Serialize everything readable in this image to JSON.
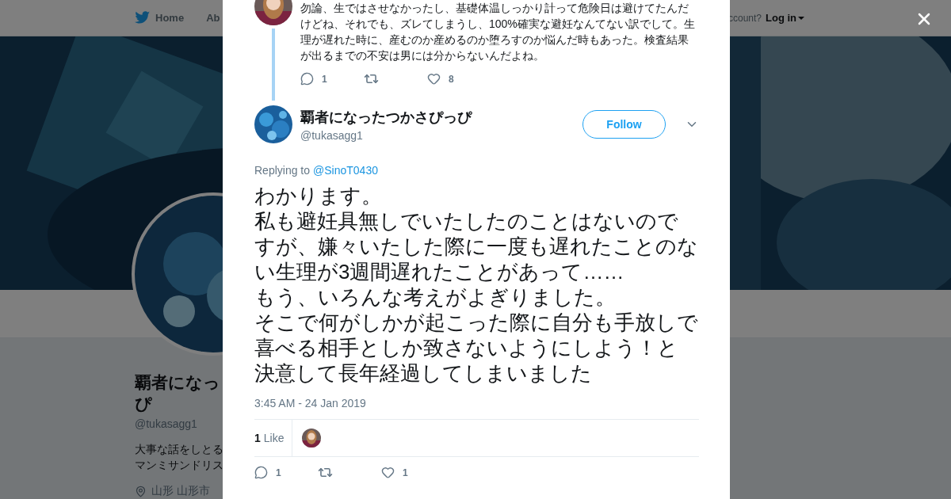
{
  "nav": {
    "items": [
      "Home",
      "Ab"
    ],
    "account_prompt": "ccount?",
    "login": "Log in"
  },
  "profile": {
    "name_lines": [
      "覇者になっ",
      "ぴ"
    ],
    "handle": "@tukasagg1",
    "bio_lines": [
      "大事な話をしとる",
      "マンミサンドリス"
    ],
    "location": "山形 山形市"
  },
  "parent_tweet": {
    "text": "勿論、生ではさせなかったし、基礎体温しっかり計って危険日は避けてたんだけどね、それでも、ズレてしまうし、100%確実な避妊なんてない訳でして。生理が遅れた時に、産むのか産めるのか堕ろすのか悩んだ時もあった。検査結果が出るまでの不安は男には分からないんだよね。",
    "actions": [
      {
        "kind": "reply",
        "count": "1"
      },
      {
        "kind": "retweet"
      },
      {
        "kind": "like",
        "count": "8"
      }
    ]
  },
  "tweet": {
    "name": "覇者になったつかさぴっぴ",
    "handle": "@tukasagg1",
    "follow": "Follow",
    "replying_label": "Replying to",
    "replying_to": "@SinoT0430",
    "paragraphs": [
      "わかります。",
      "私も避妊具無しでいたしたのことはないのですが、嫌々いたした際に一度も遅れたことのない生理が3週間遅れたことがあって……",
      "もう、いろんな考えがよぎりました。",
      "そこで何がしかが起こった際に自分も手放しで喜べる相手としか致さないようにしよう！と決意して長年経過してしまいました"
    ],
    "time": "3:45 AM - 24 Jan 2019",
    "likes_count": "1",
    "likes_label": "Like",
    "actions": [
      {
        "kind": "reply",
        "count": "1"
      },
      {
        "kind": "retweet"
      },
      {
        "kind": "like",
        "count": "1"
      }
    ]
  }
}
